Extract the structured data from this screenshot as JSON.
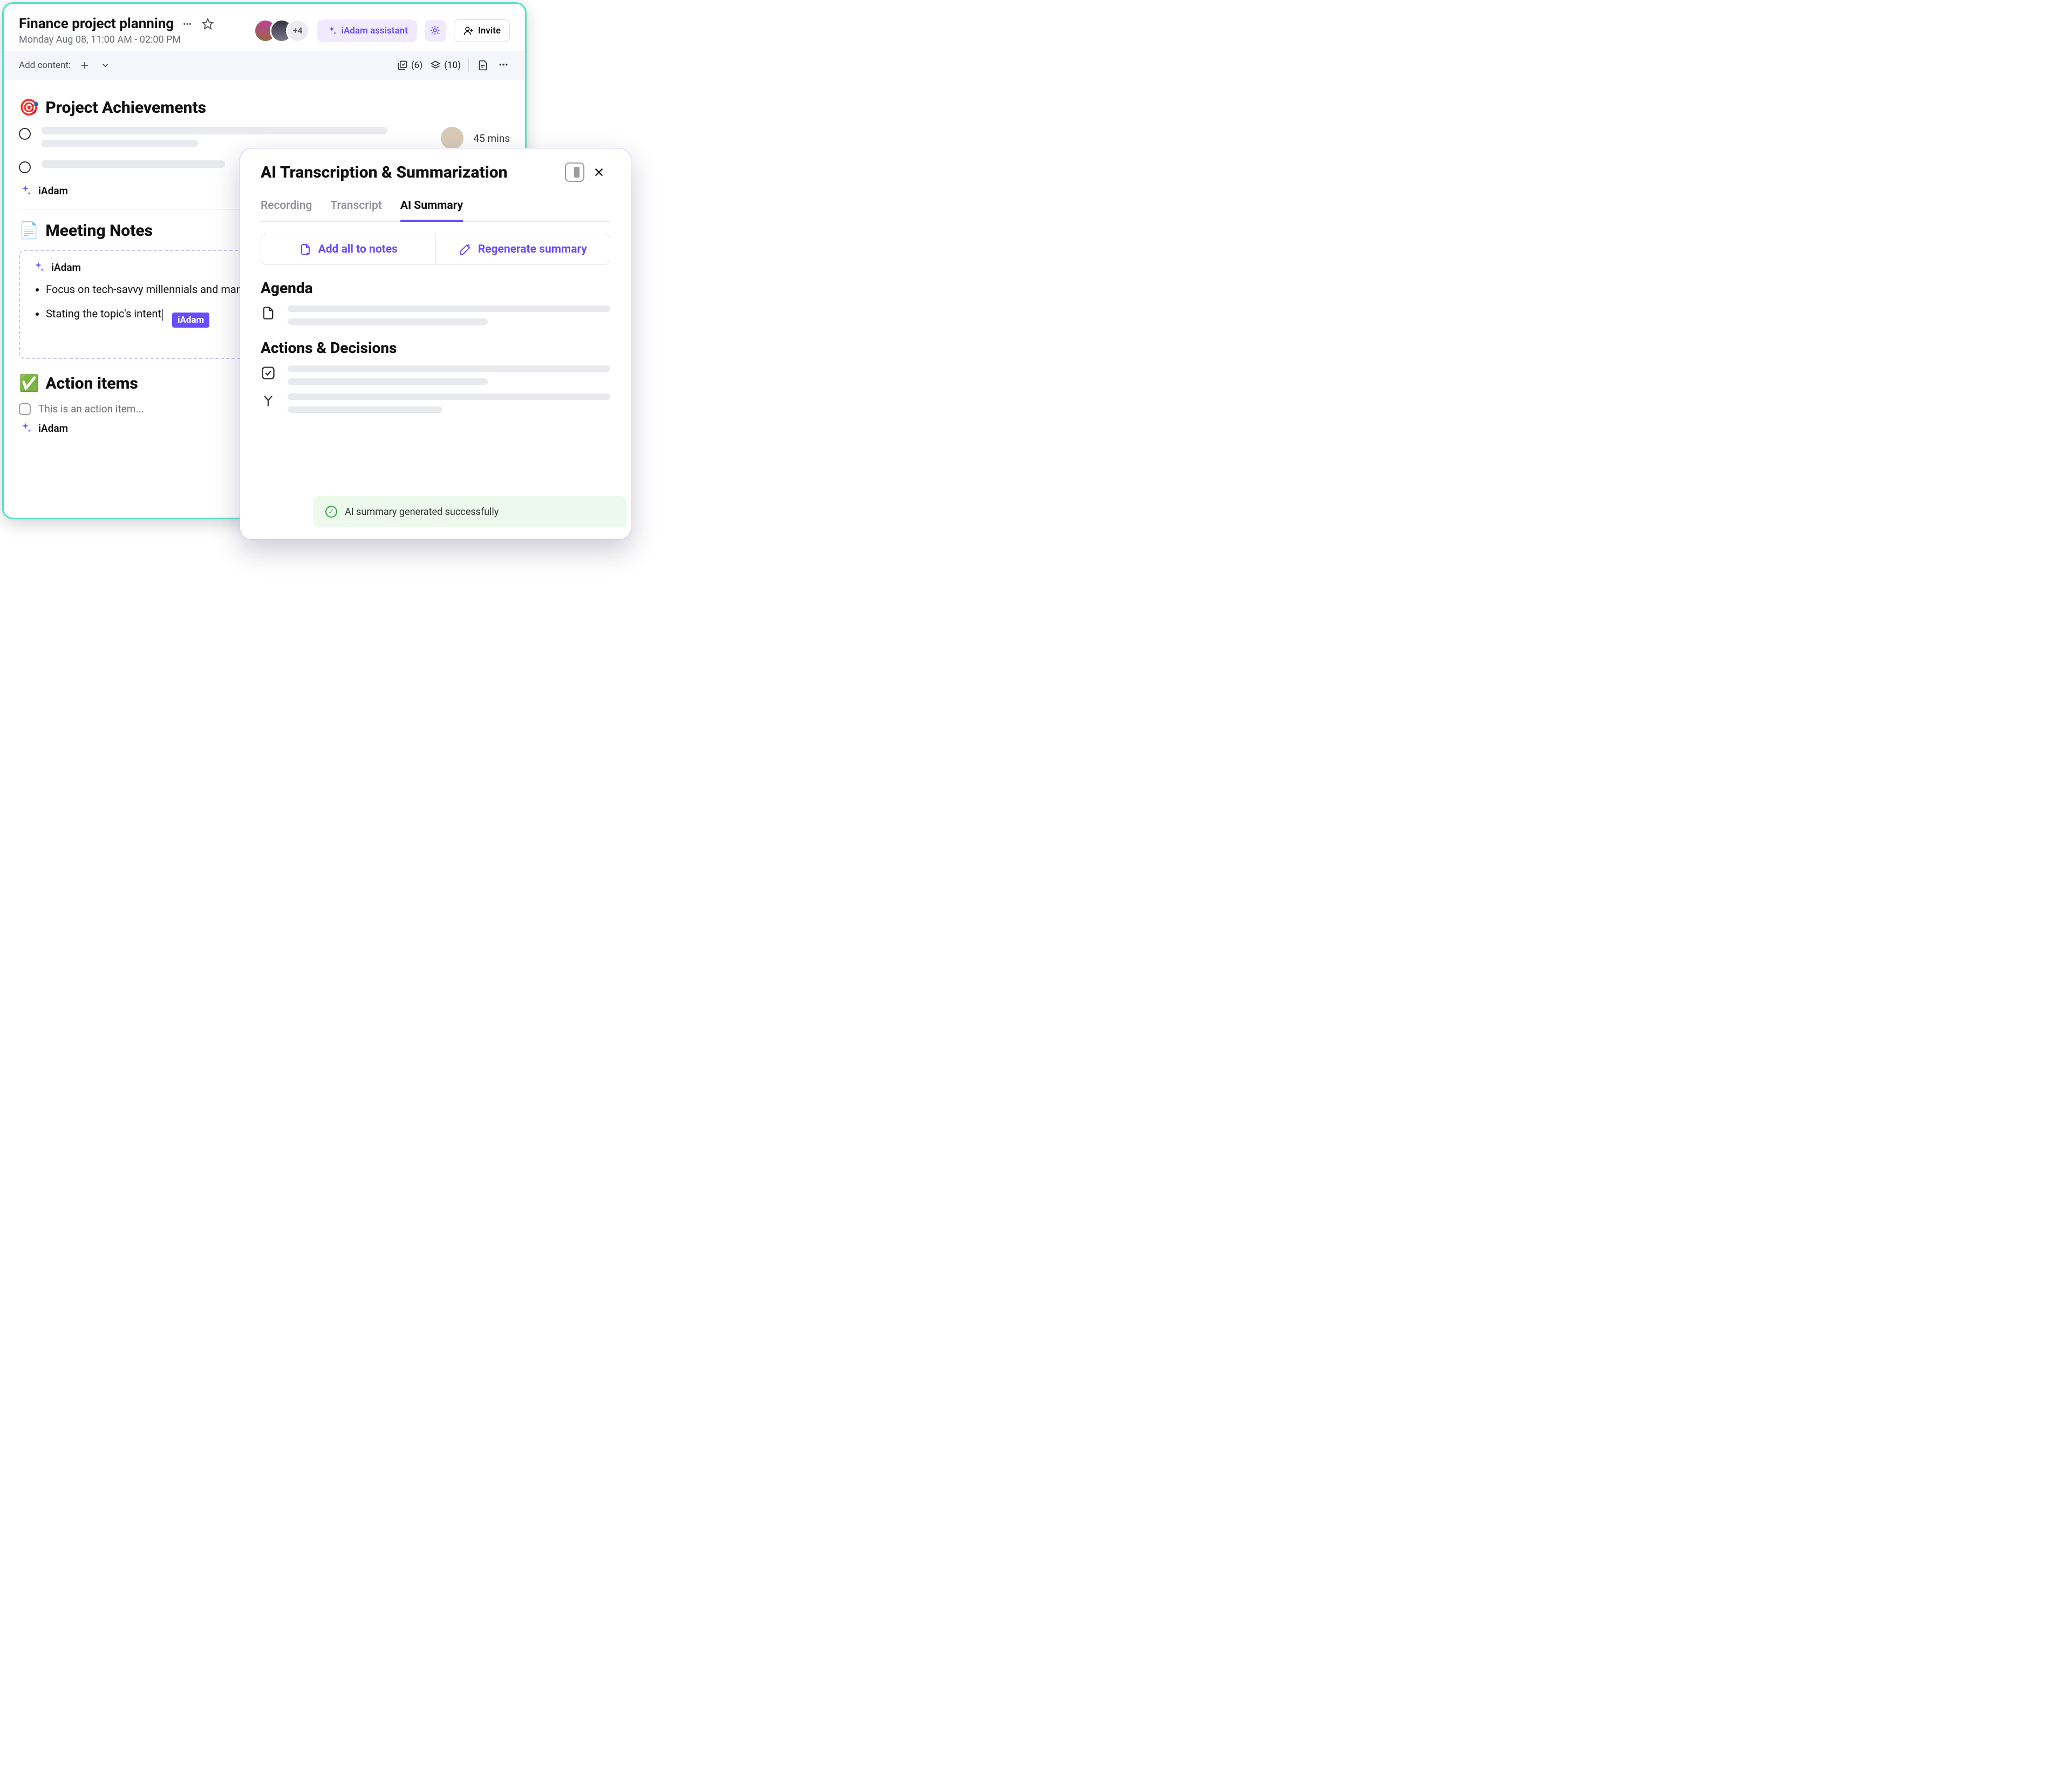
{
  "header": {
    "title": "Finance project planning",
    "subtitle": "Monday Aug 08, 11:00 AM - 02:00 PM",
    "avatars_extra": "+4",
    "assistant_btn": "iAdam assistant",
    "invite_btn": "Invite"
  },
  "toolbar": {
    "add_content_label": "Add content:",
    "count_a": "(6)",
    "count_b": "(10)"
  },
  "sections": {
    "achievements_title": "Project Achievements",
    "achievements_emoji": "🎯",
    "duration": "45 mins",
    "iadam_label": "iAdam",
    "notes_title": "Meeting Notes",
    "notes_emoji": "📄",
    "notes": {
      "author": "iAdam",
      "bullets": [
        "Focus on tech-savvy millennials and management",
        "Stating the topic's intent"
      ],
      "inline_tag": "iAdam"
    },
    "actions_title": "Action items",
    "actions_emoji": "✅",
    "action_placeholder": "This is an action item..."
  },
  "panel": {
    "title": "AI Transcription & Summarization",
    "tabs": {
      "recording": "Recording",
      "transcript": "Transcript",
      "summary": "AI Summary"
    },
    "btn_add": "Add all to notes",
    "btn_regen": "Regenerate summary",
    "h_agenda": "Agenda",
    "h_actions": "Actions & Decisions",
    "toast": "AI summary generated successfully"
  }
}
